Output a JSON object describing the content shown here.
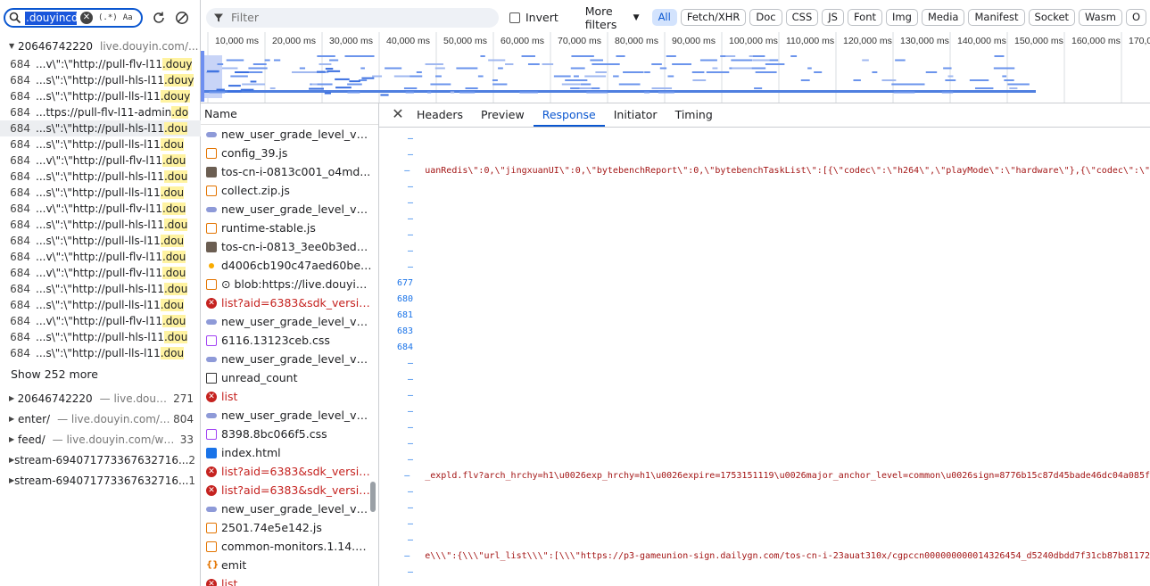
{
  "search": {
    "query": ".douyincd",
    "regex_label": "(.*)",
    "case_label": "Aa"
  },
  "result_groups_top": {
    "name": "20646742220",
    "source": "live.douyin.com/..."
  },
  "result_lines": [
    {
      "ln": "684",
      "pre": "...v\\\":\\\"http://pull-flv-l11",
      "hl": ".douy"
    },
    {
      "ln": "684",
      "pre": "...s\\\":\\\"http://pull-hls-l11",
      "hl": ".douy"
    },
    {
      "ln": "684",
      "pre": "...s\\\":\\\"http://pull-lls-l11",
      "hl": ".douy"
    },
    {
      "ln": "684",
      "pre": "...ttps://pull-flv-l11-admin",
      "hl": ".do"
    },
    {
      "ln": "684",
      "pre": "...s\\\":\\\"http://pull-hls-l11",
      "hl": ".dou"
    },
    {
      "ln": "684",
      "pre": "...s\\\":\\\"http://pull-lls-l11",
      "hl": ".dou"
    },
    {
      "ln": "684",
      "pre": "...v\\\":\\\"http://pull-flv-l11",
      "hl": ".dou"
    },
    {
      "ln": "684",
      "pre": "...s\\\":\\\"http://pull-hls-l11",
      "hl": ".dou"
    },
    {
      "ln": "684",
      "pre": "...s\\\":\\\"http://pull-lls-l11",
      "hl": ".dou"
    },
    {
      "ln": "684",
      "pre": "...v\\\":\\\"http://pull-flv-l11",
      "hl": ".dou"
    },
    {
      "ln": "684",
      "pre": "...s\\\":\\\"http://pull-hls-l11",
      "hl": ".dou"
    },
    {
      "ln": "684",
      "pre": "...s\\\":\\\"http://pull-lls-l11",
      "hl": ".dou"
    },
    {
      "ln": "684",
      "pre": "...v\\\":\\\"http://pull-flv-l11",
      "hl": ".dou"
    },
    {
      "ln": "684",
      "pre": "...v\\\":\\\"http://pull-flv-l11",
      "hl": ".dou"
    },
    {
      "ln": "684",
      "pre": "...s\\\":\\\"http://pull-hls-l11",
      "hl": ".dou"
    },
    {
      "ln": "684",
      "pre": "...s\\\":\\\"http://pull-lls-l11",
      "hl": ".dou"
    },
    {
      "ln": "684",
      "pre": "...v\\\":\\\"http://pull-flv-l11",
      "hl": ".dou"
    },
    {
      "ln": "684",
      "pre": "...s\\\":\\\"http://pull-hls-l11",
      "hl": ".dou"
    },
    {
      "ln": "684",
      "pre": "...s\\\":\\\"http://pull-lls-l11",
      "hl": ".dou"
    }
  ],
  "show_more": "Show 252 more",
  "result_groups": [
    {
      "name": "20646742220",
      "source": "live.douyi...",
      "count": "271"
    },
    {
      "name": "enter/",
      "source": "live.douyin.com/...",
      "count": "804"
    },
    {
      "name": "feed/",
      "source": "live.douyin.com/we...",
      "count": "33"
    },
    {
      "name": "stream-694071773367632716...",
      "source": "",
      "count": "2"
    },
    {
      "name": "stream-694071773367632716...",
      "source": "",
      "count": "1"
    }
  ],
  "toolbar": {
    "filter_placeholder": "Filter",
    "invert_label": "Invert",
    "more_filters_label": "More filters",
    "type_chips": [
      "All",
      "Fetch/XHR",
      "Doc",
      "CSS",
      "JS",
      "Font",
      "Img",
      "Media",
      "Manifest",
      "Socket",
      "Wasm",
      "O"
    ]
  },
  "timeline": {
    "ticks": [
      "10,000 ms",
      "20,000 ms",
      "30,000 ms",
      "40,000 ms",
      "50,000 ms",
      "60,000 ms",
      "70,000 ms",
      "80,000 ms",
      "90,000 ms",
      "100,000 ms",
      "110,000 ms",
      "120,000 ms",
      "130,000 ms",
      "140,000 ms",
      "150,000 ms",
      "160,000 ms",
      "170,00"
    ]
  },
  "request_list": {
    "header": "Name",
    "items": [
      {
        "type": "xhr",
        "name": "new_user_grade_level_v1_..."
      },
      {
        "type": "js",
        "name": "config_39.js"
      },
      {
        "type": "img",
        "name": "tos-cn-i-0813c001_o4md..."
      },
      {
        "type": "js",
        "name": "collect.zip.js"
      },
      {
        "type": "xhr",
        "name": "new_user_grade_level_v1_..."
      },
      {
        "type": "js",
        "name": "runtime-stable.js"
      },
      {
        "type": "img",
        "name": "tos-cn-i-0813_3ee0b3edd..."
      },
      {
        "type": "dot",
        "name": "d4006cb190c47aed60be5..."
      },
      {
        "type": "js",
        "name": "⊙ blob:https://live.douyin..."
      },
      {
        "type": "err",
        "name": "list?aid=6383&sdk_versio..."
      },
      {
        "type": "xhr",
        "name": "new_user_grade_level_v1_..."
      },
      {
        "type": "css",
        "name": "6116.13123ceb.css"
      },
      {
        "type": "xhr",
        "name": "new_user_grade_level_v1_..."
      },
      {
        "type": "doc",
        "name": "unread_count"
      },
      {
        "type": "err",
        "name": "list"
      },
      {
        "type": "xhr",
        "name": "new_user_grade_level_v1_..."
      },
      {
        "type": "css",
        "name": "8398.8bc066f5.css"
      },
      {
        "type": "html",
        "name": "index.html"
      },
      {
        "type": "err",
        "name": "list?aid=6383&sdk_versio..."
      },
      {
        "type": "err",
        "name": "list?aid=6383&sdk_versio..."
      },
      {
        "type": "xhr",
        "name": "new_user_grade_level_v1_..."
      },
      {
        "type": "js",
        "name": "2501.74e5e142.js"
      },
      {
        "type": "js",
        "name": "common-monitors.1.14.4.js"
      },
      {
        "type": "emit",
        "name": "emit"
      },
      {
        "type": "err",
        "name": "list"
      }
    ]
  },
  "detail": {
    "tabs": [
      "Headers",
      "Preview",
      "Response",
      "Initiator",
      "Timing"
    ],
    "active_tab": "Response",
    "lines": [
      {
        "g": "–",
        "t": ""
      },
      {
        "g": "–",
        "t": ""
      },
      {
        "g": "–",
        "t": "uanRedis\\\":0,\\\"jingxuanUI\\\":0,\\\"bytebenchReport\\\":0,\\\"bytebenchTaskList\\\":[{\\\"codec\\\":\\\"h264\\\",\\\"playMode\\\":\\\"hardware\\\"},{\\\"codec\\\":\\\""
      },
      {
        "g": "–",
        "t": ""
      },
      {
        "g": "–",
        "t": ""
      },
      {
        "g": "–",
        "t": ""
      },
      {
        "g": "–",
        "t": ""
      },
      {
        "g": "–",
        "t": ""
      },
      {
        "g": "–",
        "t": ""
      },
      {
        "g": "677",
        "t": ""
      },
      {
        "g": "680",
        "t": ""
      },
      {
        "g": "681",
        "t": ""
      },
      {
        "g": "683",
        "t": ""
      },
      {
        "g": "684",
        "t": ""
      },
      {
        "g": "–",
        "t": ""
      },
      {
        "g": "–",
        "t": ""
      },
      {
        "g": "–",
        "t": ""
      },
      {
        "g": "–",
        "t": ""
      },
      {
        "g": "–",
        "t": ""
      },
      {
        "g": "–",
        "t": ""
      },
      {
        "g": "–",
        "t": ""
      },
      {
        "g": "–",
        "t": "_expld.flv?arch_hrchy=h1\\u0026exp_hrchy=h1\\u0026expire=1753151119\\u0026major_anchor_level=common\\u0026sign=8776b15c87d45bade46dc04a085f"
      },
      {
        "g": "–",
        "t": ""
      },
      {
        "g": "–",
        "t": ""
      },
      {
        "g": "–",
        "t": ""
      },
      {
        "g": "–",
        "t": ""
      },
      {
        "g": "–",
        "t": "e\\\\\\\":{\\\\\\\"url_list\\\\\\\":[\\\\\\\"https://p3-gameunion-sign.dailygn.com/tos-cn-i-23auat310x/cgpccn000000000014326454_d5240dbdd7f31cb87b81172"
      },
      {
        "g": "–",
        "t": ""
      }
    ]
  },
  "colors": {
    "accent": "#0b57d0",
    "highlight": "#fff3a1",
    "error": "#c5221f",
    "timeline_bar": "#4f7fe0"
  }
}
